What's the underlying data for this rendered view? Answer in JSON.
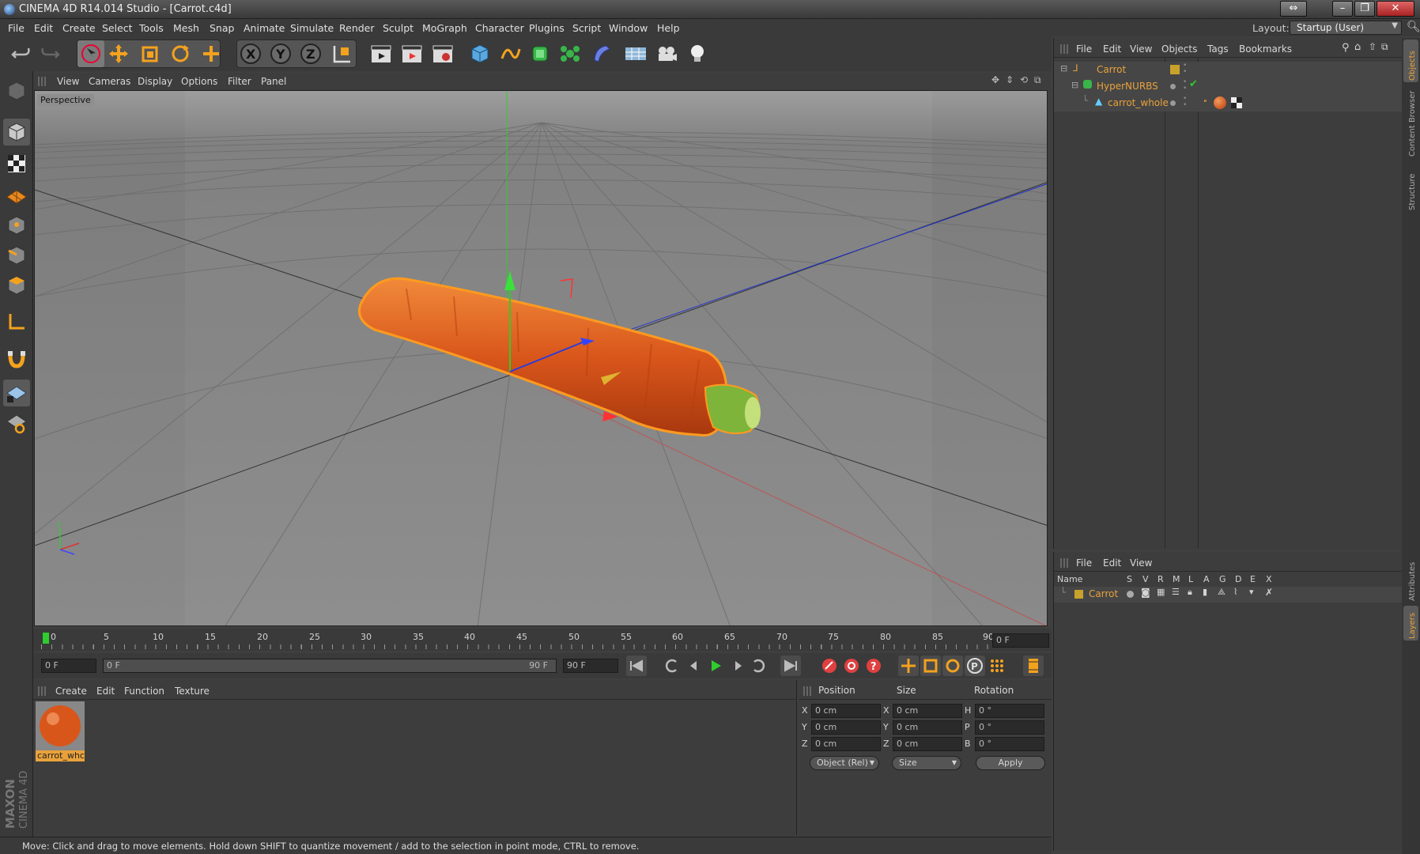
{
  "window": {
    "title": "CINEMA 4D R14.014 Studio - [Carrot.c4d]"
  },
  "menubar": {
    "items": [
      "File",
      "Edit",
      "Create",
      "Select",
      "Tools",
      "Mesh",
      "Snap",
      "Animate",
      "Simulate",
      "Render",
      "Sculpt",
      "MoGraph",
      "Character",
      "Plugins",
      "Script",
      "Window",
      "Help"
    ],
    "layout_label": "Layout:",
    "layout_value": "Startup (User)"
  },
  "viewport": {
    "menu": [
      "View",
      "Cameras",
      "Display",
      "Options",
      "Filter",
      "Panel"
    ],
    "label": "Perspective"
  },
  "timeline": {
    "ticks": [
      "0",
      "5",
      "10",
      "15",
      "20",
      "25",
      "30",
      "35",
      "40",
      "45",
      "50",
      "55",
      "60",
      "65",
      "70",
      "75",
      "80",
      "85",
      "90"
    ],
    "frame_field": "0 F"
  },
  "transport": {
    "current": "0 F",
    "range_start": "0 F",
    "range_end": "90 F",
    "end": "90 F"
  },
  "material_panel": {
    "menu": [
      "Create",
      "Edit",
      "Function",
      "Texture"
    ],
    "material_name": "carrot_whc"
  },
  "coords": {
    "headers": [
      "Position",
      "Size",
      "Rotation"
    ],
    "rows": [
      {
        "axis": "X",
        "pos": "0 cm",
        "size_axis": "X",
        "size": "0 cm",
        "rot_axis": "H",
        "rot": "0 °"
      },
      {
        "axis": "Y",
        "pos": "0 cm",
        "size_axis": "Y",
        "size": "0 cm",
        "rot_axis": "P",
        "rot": "0 °"
      },
      {
        "axis": "Z",
        "pos": "0 cm",
        "size_axis": "Z",
        "size": "0 cm",
        "rot_axis": "B",
        "rot": "0 °"
      }
    ],
    "mode": "Object (Rel)",
    "size_mode": "Size",
    "apply": "Apply"
  },
  "object_manager": {
    "menu": [
      "File",
      "Edit",
      "View",
      "Objects",
      "Tags",
      "Bookmarks"
    ],
    "objects": [
      {
        "name": "Carrot"
      },
      {
        "name": "HyperNURBS"
      },
      {
        "name": "carrot_whole"
      }
    ]
  },
  "layer_manager": {
    "menu": [
      "File",
      "Edit",
      "View"
    ],
    "columns": [
      "Name",
      "S",
      "V",
      "R",
      "M",
      "L",
      "A",
      "G",
      "D",
      "E",
      "X"
    ],
    "layer": "Carrot"
  },
  "side_tabs": [
    "Objects",
    "Content Browser",
    "Structure",
    "Attributes",
    "Layers"
  ],
  "branding": {
    "maxon": "MAXON",
    "product": "CINEMA 4D"
  },
  "status": "Move: Click and drag to move elements. Hold down SHIFT to quantize movement / add to the selection in point mode, CTRL to remove.",
  "colors": {
    "accent": "#e9a23b",
    "carrot": "#d9561b",
    "highlight": "#ff9a1f"
  }
}
